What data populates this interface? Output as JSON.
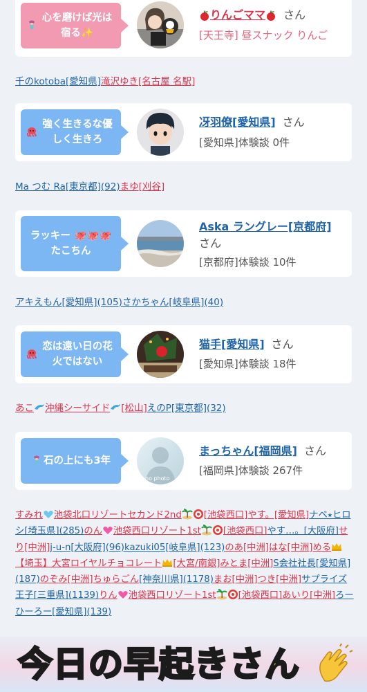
{
  "cards": [
    {
      "bubble": "心を磨けば光は宿る✨",
      "name": "りんごママ",
      "san": "さん",
      "meta": "[天王寺] 昼スナック りんご"
    },
    {
      "bubble": "強く生きるな優しく生きろ",
      "name": "冴羽僚[愛知県]",
      "san": "さん",
      "meta": "[愛知県]体験談 0件"
    },
    {
      "bubble": "ラッキー 🐙🐙🐙 たこちん",
      "name": "Aska ラングレー[京都府]",
      "san": "さん",
      "meta": "[京都府]体験談 10件"
    },
    {
      "bubble": "恋は遠い日の花火ではない",
      "name": "猫手[愛知県]",
      "san": "さん",
      "meta": "[愛知県]体験談 18件"
    },
    {
      "bubble": "石の上にも3年",
      "name": "まっちゃん[福岡県]",
      "san": "さん",
      "meta": "[福岡県]体験談 267件",
      "no_photo": "no photo"
    }
  ],
  "strips": {
    "s1": [
      "千のkotoba[愛知県]",
      "滝沢ゆき[名古屋 名駅]"
    ],
    "s2": [
      "Ma つむ Ra[東京都](92)",
      "まゆ[刈谷]"
    ],
    "s3": [
      "アキえもん[愛知県](105)",
      "さかちゃん[岐阜県](40)"
    ],
    "s4": [
      "あこ",
      "沖縄シーサイド",
      "[松山]",
      "えのP[東京都](32)"
    ]
  },
  "para": {
    "p1": "すみれ",
    "p2": "池袋北口リゾートセカンド2nd",
    "p3": "[池袋西口]",
    "p4": "やす。[愛知県]",
    "p5": "ナベ⭑ヒロシ[埼玉県](285)",
    "p6": "のん",
    "p7": "池袋西口リゾート1st",
    "p8": "[池袋西口]",
    "p9": "やす…。[大阪府]",
    "p10": "せり[中洲]",
    "p11": "j-u-n[大阪府](96)",
    "p12": "kazuki05[岐阜県](123)",
    "p13": "のあ[中洲]",
    "p14": "はな[中洲]",
    "p15": "める",
    "p16": "【埼玉】大宮ロイヤルチョコレート",
    "p17": "[大宮/南銀]",
    "p18": "みとま[中洲]",
    "p19": "S会社社長[愛知県](187)",
    "p20": "のぞみ[中洲]",
    "p21": "ちゅらごん",
    "p22": "[神奈川県](1178)",
    "p23": "まお[中洲]",
    "p24": "つき[中洲]",
    "p25": "サプライズ王子[三重県](1139)",
    "p26": "りん",
    "p27": "池袋西口リゾート1st",
    "p28": "[池袋西口]",
    "p29": "あいり[中洲]",
    "p30": "ろーひーろー[愛知県](139)"
  },
  "banner": "今日の早起きさん",
  "colors": {
    "link_blue": "#1f64a8",
    "link_red": "#d9354b",
    "bubble_pink": "#f19ab1",
    "bubble_blue": "#7db7f3",
    "background": "#eef1f6",
    "banner_text": "#ffe83a"
  },
  "icons": [
    "apple-icon",
    "octopus-icon",
    "mermaid-icon",
    "dolphin-icon",
    "heart-icon",
    "crown-icon",
    "palm-island-icon",
    "target-icon",
    "clap-icon"
  ]
}
